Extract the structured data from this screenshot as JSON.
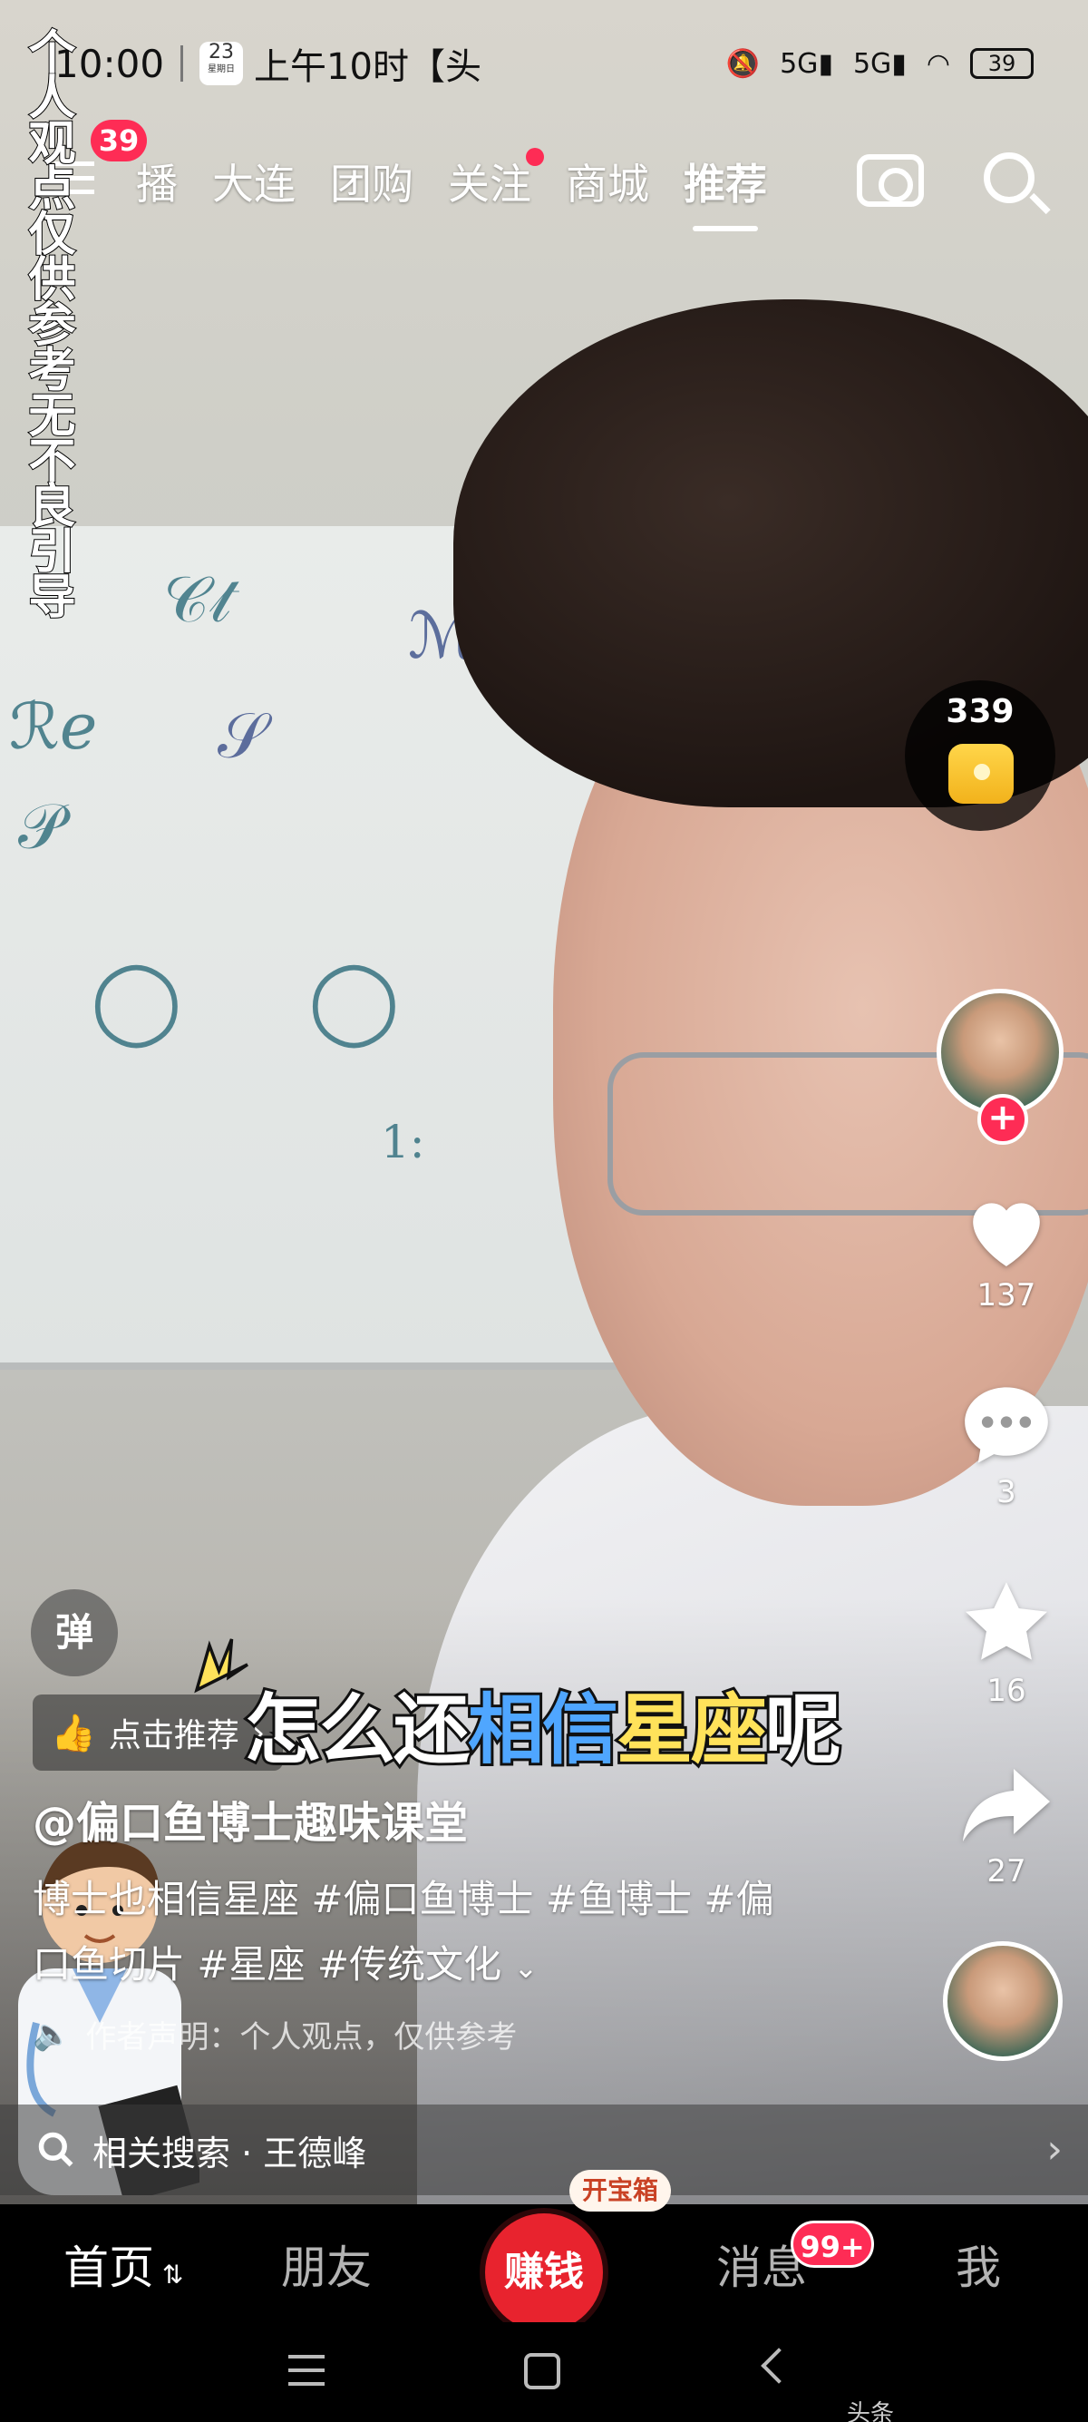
{
  "status_bar": {
    "time": "10:00",
    "calendar_day": "23",
    "calendar_sub": "星期日",
    "notification": "上午10时【头",
    "signal1": "5G",
    "signal2": "5G",
    "battery": "39"
  },
  "disclaimer_vertical": "个人观点仅供参考无不良引导",
  "top_nav": {
    "menu_badge": "39",
    "items": [
      {
        "label": "播",
        "active": false
      },
      {
        "label": "大连",
        "active": false
      },
      {
        "label": "团购",
        "active": false
      },
      {
        "label": "关注",
        "active": false,
        "dot": true
      },
      {
        "label": "商城",
        "active": false
      },
      {
        "label": "推荐",
        "active": true
      }
    ]
  },
  "treasure": {
    "count": "339"
  },
  "actions": {
    "like_count": "137",
    "comment_count": "3",
    "favorite_count": "16",
    "share_count": "27"
  },
  "danmu_label": "弹",
  "recommend": {
    "label": "点击推荐"
  },
  "subtitle": {
    "part1": "怎么还",
    "part2": "相信",
    "part3": "星座",
    "part4": "呢"
  },
  "post": {
    "author": "@偏口鱼博士趣味课堂",
    "desc_line1": "博士也相信星座 #偏口鱼博士 #鱼博士 #偏",
    "desc_line2": "口鱼切片 #星座 #传统文化",
    "declaration": "作者声明：个人观点，仅供参考"
  },
  "related_search": {
    "label": "相关搜索 · 王德峰"
  },
  "tabbar": {
    "home": "首页",
    "friends": "朋友",
    "earn": "赚钱",
    "earn_tag": "开宝箱",
    "messages": "消息",
    "messages_badge": "99+",
    "me": "我"
  },
  "system_nav": {
    "tag": "头条"
  }
}
